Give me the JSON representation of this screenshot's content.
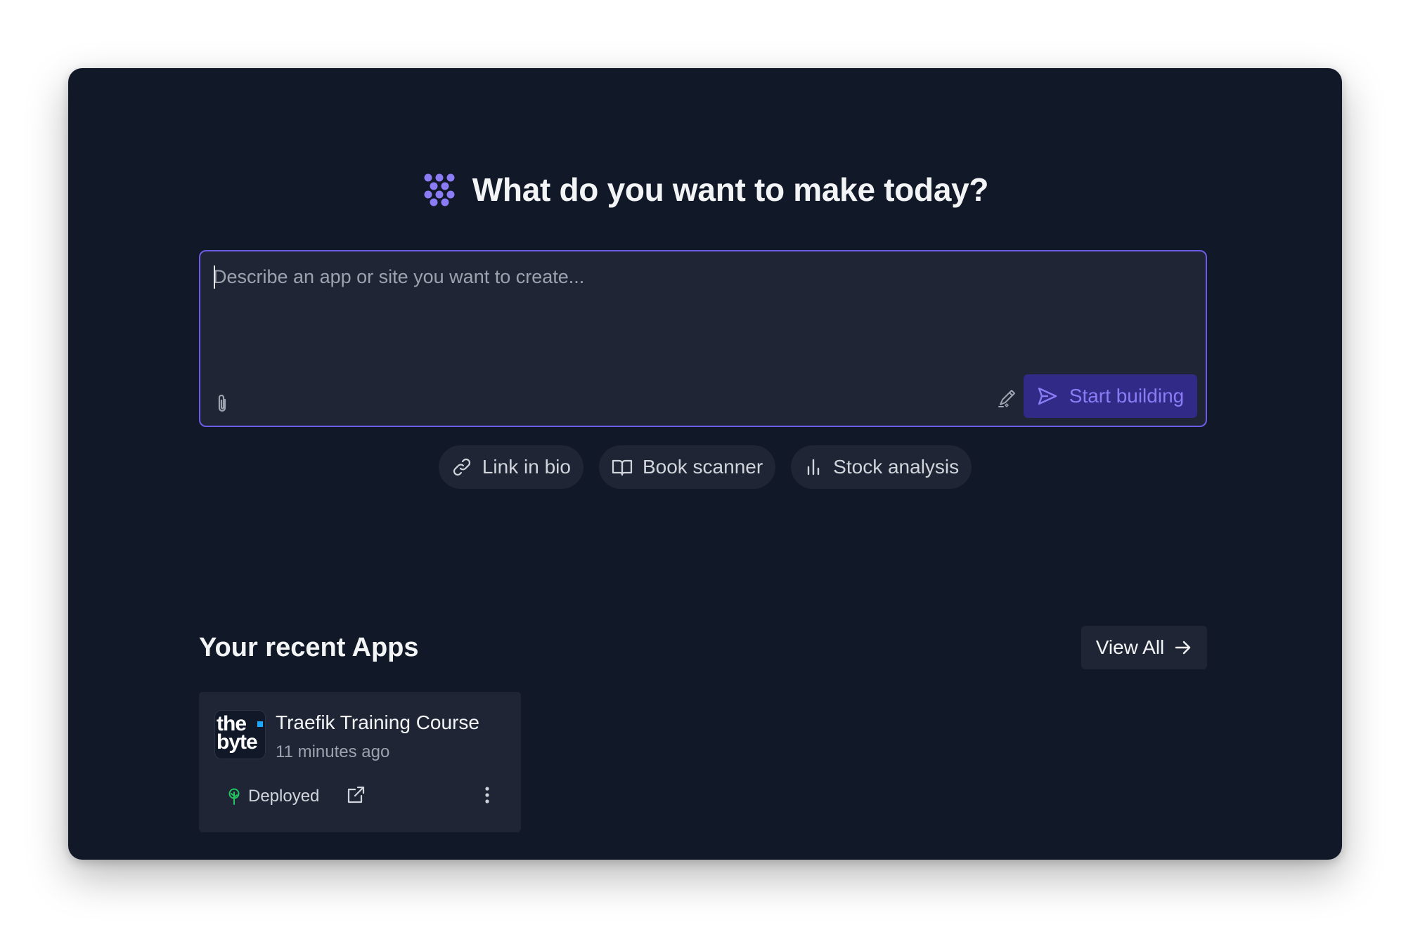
{
  "hero": {
    "title": "What do you want to make today?",
    "logo_icon": "grid-dots-logo-icon",
    "accent_color": "#8b7cf6"
  },
  "prompt": {
    "placeholder": "Describe an app or site you want to create...",
    "value": "",
    "attach_icon": "paperclip-icon",
    "enhance_icon": "magic-pen-icon",
    "start_icon": "send-icon",
    "start_label": "Start building"
  },
  "suggestions": [
    {
      "icon": "link-icon",
      "label": "Link in bio"
    },
    {
      "icon": "book-open-icon",
      "label": "Book scanner"
    },
    {
      "icon": "bar-chart-icon",
      "label": "Stock analysis"
    }
  ],
  "recent": {
    "title": "Your recent Apps",
    "view_all_label": "View All",
    "view_all_icon": "arrow-right-icon",
    "apps": [
      {
        "thumb_line1": "the",
        "thumb_line2": "byte",
        "name": "Traefik Training Course",
        "time": "11 minutes ago",
        "status_icon": "tree-icon",
        "status": "Deployed",
        "status_color": "#22c55e",
        "open_icon": "external-link-icon",
        "more_icon": "more-vertical-icon"
      }
    ]
  },
  "colors": {
    "background": "#111827",
    "surface": "#1f2535",
    "border_focus": "#6d5ce6",
    "button_primary_bg": "#312a86"
  }
}
